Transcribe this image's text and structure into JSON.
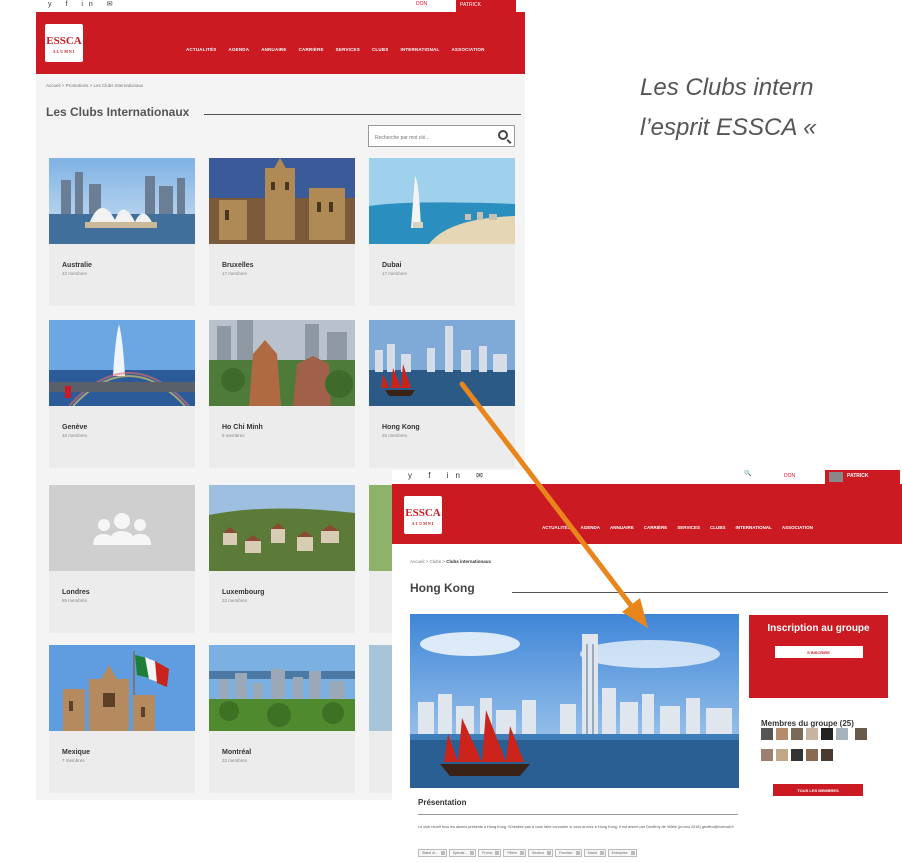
{
  "quote": {
    "line1": "Les Clubs intern",
    "line2": "l’esprit ESSCA «"
  },
  "left": {
    "social_icons": "y f in ✉",
    "don": "DON",
    "user": "PATRICK",
    "logo": {
      "main": "ESSCA",
      "sub": "ALUMNI"
    },
    "menu": [
      "ACTUALITÉS",
      "AGENDA",
      "ANNUAIRE",
      "CARRIÈRE",
      "SERVICES",
      "CLUBS",
      "INTERNATIONAL",
      "ASSOCIATION"
    ],
    "breadcrumb": "Accueil > Promotions > Les Clubs Internationaux",
    "page_title": "Les Clubs Internationaux",
    "search_placeholder": "Recherche par mot clé...",
    "cards": [
      {
        "name": "Australie",
        "members": "22 membres"
      },
      {
        "name": "Bruxelles",
        "members": "17 membres"
      },
      {
        "name": "Dubai",
        "members": "17 membres"
      },
      {
        "name": "Genève",
        "members": "48 membres"
      },
      {
        "name": "Ho Chi Minh",
        "members": "8 membres"
      },
      {
        "name": "Hong Kong",
        "members": "25 membres"
      },
      {
        "name": "Londres",
        "members": "85 membres"
      },
      {
        "name": "Luxembourg",
        "members": "22 membres"
      },
      {
        "name": "Mexique",
        "members": "7 membres"
      },
      {
        "name": "Montréal",
        "members": "22 membres"
      }
    ]
  },
  "right": {
    "social_icons": "y f in ✉",
    "search_glyph": "🔍",
    "don": "DON",
    "user": "PATRICK",
    "logo": {
      "main": "ESSCA",
      "sub": "ALUMNI"
    },
    "menu": [
      "ACTUALITÉS",
      "AGENDA",
      "ANNUAIRE",
      "CARRIÈRE",
      "SERVICES",
      "CLUBS",
      "INTERNATIONAL",
      "ASSOCIATION"
    ],
    "breadcrumb_prefix": "Accueil > Clubs > ",
    "breadcrumb_current": "Clubs internationaux",
    "page_title": "Hong Kong",
    "inscription_title": "Inscription au groupe",
    "inscription_button": "S'INSCRIRE",
    "members_label": "Membres du groupe (25)",
    "all_members_button": "TOUS LES MEMBRES",
    "presentation_title": "Présentation",
    "presentation_text": "Le club réunit tous les alumni présents à Hong Kong. N'hésitez pas à vous faire connaître si vous arrivez à Hong Kong. Il est animé par Geoffroy de Villèle (promo 2016) geoffroi@hotmail.fr",
    "filters": [
      "Statut di...",
      "Spécial...",
      "Promo",
      "Filière",
      "Secteur",
      "Fonction",
      "Statut",
      "Entreprise"
    ]
  },
  "colors": {
    "brand_red": "#cc1a22",
    "arrow": "#e8861c"
  }
}
